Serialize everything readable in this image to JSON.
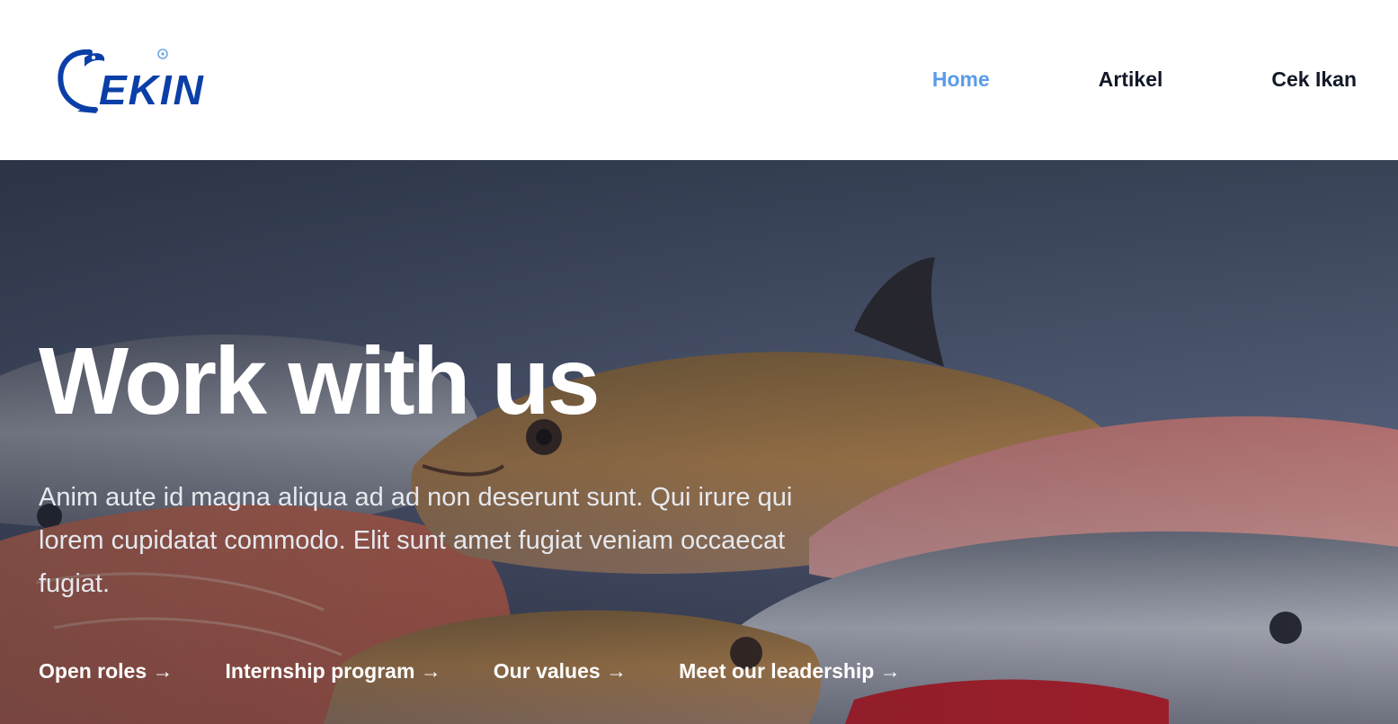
{
  "brand": {
    "logo_text": "EKIN",
    "accent_color": "#0b3fa8"
  },
  "nav": {
    "items": [
      {
        "label": "Home",
        "active": true
      },
      {
        "label": "Artikel",
        "active": false
      },
      {
        "label": "Cek Ikan",
        "active": false
      }
    ],
    "active_color": "#5b9bea",
    "text_color": "#111827"
  },
  "hero": {
    "title": "Work with us",
    "description": "Anim aute id magna aliqua ad ad non deserunt sunt. Qui irure qui lorem cupidatat commodo. Elit sunt amet fugiat veniam occaecat fugiat.",
    "background_icon": "fish-market-photo",
    "links": [
      {
        "label": "Open roles",
        "arrow": "→"
      },
      {
        "label": "Internship program",
        "arrow": "→"
      },
      {
        "label": "Our values",
        "arrow": "→"
      },
      {
        "label": "Meet our leadership",
        "arrow": "→"
      }
    ]
  }
}
